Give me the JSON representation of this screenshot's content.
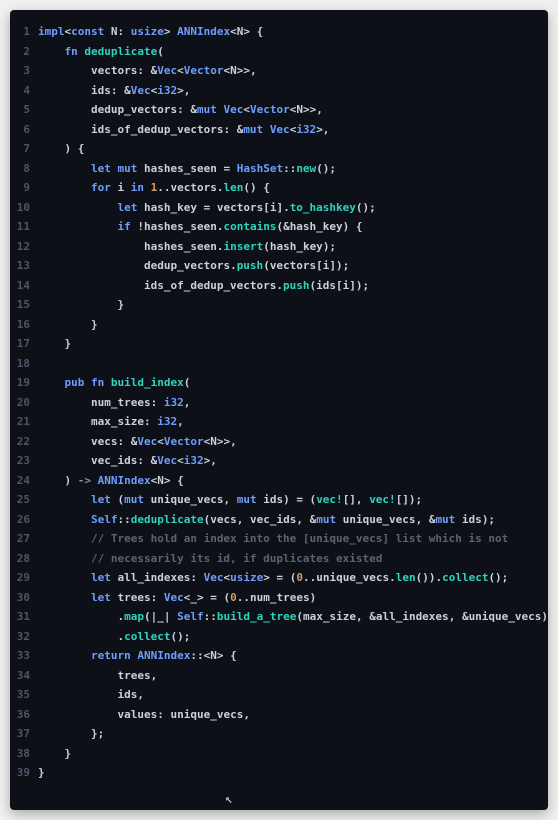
{
  "colors": {
    "bg": "#0d1117",
    "gutter": "#4a5568",
    "default": "#c9d1d9",
    "keyword": "#6f9dff",
    "function": "#2dd4bf",
    "type": "#6f9dff",
    "number": "#d19a66",
    "comment": "#5c6370"
  },
  "lines": [
    {
      "n": 1,
      "tokens": [
        [
          "key",
          "impl"
        ],
        [
          "punct",
          "<"
        ],
        [
          "key",
          "const"
        ],
        [
          "ident",
          " N"
        ],
        [
          "punct",
          ": "
        ],
        [
          "type",
          "usize"
        ],
        [
          "punct",
          "> "
        ],
        [
          "type",
          "ANNIndex"
        ],
        [
          "punct",
          "<"
        ],
        [
          "ident",
          "N"
        ],
        [
          "punct",
          "> {"
        ]
      ]
    },
    {
      "n": 2,
      "indent": 4,
      "tokens": [
        [
          "key",
          "fn "
        ],
        [
          "func",
          "deduplicate"
        ],
        [
          "punct",
          "("
        ]
      ]
    },
    {
      "n": 3,
      "indent": 8,
      "tokens": [
        [
          "ident",
          "vectors"
        ],
        [
          "punct",
          ": "
        ],
        [
          "amp",
          "&"
        ],
        [
          "type",
          "Vec"
        ],
        [
          "punct",
          "<"
        ],
        [
          "type",
          "Vector"
        ],
        [
          "punct",
          "<"
        ],
        [
          "ident",
          "N"
        ],
        [
          "punct",
          ">>,"
        ]
      ]
    },
    {
      "n": 4,
      "indent": 8,
      "tokens": [
        [
          "ident",
          "ids"
        ],
        [
          "punct",
          ": "
        ],
        [
          "amp",
          "&"
        ],
        [
          "type",
          "Vec"
        ],
        [
          "punct",
          "<"
        ],
        [
          "type",
          "i32"
        ],
        [
          "punct",
          ">,"
        ]
      ]
    },
    {
      "n": 5,
      "indent": 8,
      "tokens": [
        [
          "ident",
          "dedup_vectors"
        ],
        [
          "punct",
          ": "
        ],
        [
          "amp",
          "&"
        ],
        [
          "key",
          "mut"
        ],
        [
          "ident",
          " "
        ],
        [
          "type",
          "Vec"
        ],
        [
          "punct",
          "<"
        ],
        [
          "type",
          "Vector"
        ],
        [
          "punct",
          "<"
        ],
        [
          "ident",
          "N"
        ],
        [
          "punct",
          ">>,"
        ]
      ]
    },
    {
      "n": 6,
      "indent": 8,
      "tokens": [
        [
          "ident",
          "ids_of_dedup_vectors"
        ],
        [
          "punct",
          ": "
        ],
        [
          "amp",
          "&"
        ],
        [
          "key",
          "mut"
        ],
        [
          "ident",
          " "
        ],
        [
          "type",
          "Vec"
        ],
        [
          "punct",
          "<"
        ],
        [
          "type",
          "i32"
        ],
        [
          "punct",
          ">,"
        ]
      ]
    },
    {
      "n": 7,
      "indent": 4,
      "tokens": [
        [
          "punct",
          ") {"
        ]
      ]
    },
    {
      "n": 8,
      "indent": 8,
      "tokens": [
        [
          "key",
          "let"
        ],
        [
          "ident",
          " "
        ],
        [
          "key",
          "mut"
        ],
        [
          "ident",
          " hashes_seen = "
        ],
        [
          "type",
          "HashSet"
        ],
        [
          "punct",
          "::"
        ],
        [
          "method",
          "new"
        ],
        [
          "punct",
          "();"
        ]
      ]
    },
    {
      "n": 9,
      "indent": 8,
      "tokens": [
        [
          "key",
          "for"
        ],
        [
          "ident",
          " i "
        ],
        [
          "key",
          "in"
        ],
        [
          "ident",
          " "
        ],
        [
          "num",
          "1"
        ],
        [
          "punct",
          ".."
        ],
        [
          "ident",
          "vectors"
        ],
        [
          "punct",
          "."
        ],
        [
          "method",
          "len"
        ],
        [
          "punct",
          "() {"
        ]
      ]
    },
    {
      "n": 10,
      "indent": 12,
      "tokens": [
        [
          "key",
          "let"
        ],
        [
          "ident",
          " hash_key = vectors["
        ],
        [
          "ident",
          "i"
        ],
        [
          "ident",
          "]"
        ],
        [
          "punct",
          "."
        ],
        [
          "method",
          "to_hashkey"
        ],
        [
          "punct",
          "();"
        ]
      ]
    },
    {
      "n": 11,
      "indent": 12,
      "tokens": [
        [
          "key",
          "if"
        ],
        [
          "ident",
          " !hashes_seen"
        ],
        [
          "punct",
          "."
        ],
        [
          "method",
          "contains"
        ],
        [
          "punct",
          "("
        ],
        [
          "amp",
          "&"
        ],
        [
          "ident",
          "hash_key"
        ],
        [
          "punct",
          ") {"
        ]
      ]
    },
    {
      "n": 12,
      "indent": 16,
      "tokens": [
        [
          "ident",
          "hashes_seen"
        ],
        [
          "punct",
          "."
        ],
        [
          "method",
          "insert"
        ],
        [
          "punct",
          "("
        ],
        [
          "ident",
          "hash_key"
        ],
        [
          "punct",
          ");"
        ]
      ]
    },
    {
      "n": 13,
      "indent": 16,
      "tokens": [
        [
          "ident",
          "dedup_vectors"
        ],
        [
          "punct",
          "."
        ],
        [
          "method",
          "push"
        ],
        [
          "punct",
          "("
        ],
        [
          "ident",
          "vectors"
        ],
        [
          "punct",
          "["
        ],
        [
          "ident",
          "i"
        ],
        [
          "punct",
          "]);"
        ]
      ]
    },
    {
      "n": 14,
      "indent": 16,
      "tokens": [
        [
          "ident",
          "ids_of_dedup_vectors"
        ],
        [
          "punct",
          "."
        ],
        [
          "method",
          "push"
        ],
        [
          "punct",
          "("
        ],
        [
          "ident",
          "ids"
        ],
        [
          "punct",
          "["
        ],
        [
          "ident",
          "i"
        ],
        [
          "punct",
          "]);"
        ]
      ]
    },
    {
      "n": 15,
      "indent": 12,
      "tokens": [
        [
          "punct",
          "}"
        ]
      ]
    },
    {
      "n": 16,
      "indent": 8,
      "tokens": [
        [
          "punct",
          "}"
        ]
      ]
    },
    {
      "n": 17,
      "indent": 4,
      "tokens": [
        [
          "punct",
          "}"
        ]
      ]
    },
    {
      "n": 18,
      "indent": 0,
      "tokens": []
    },
    {
      "n": 19,
      "indent": 4,
      "tokens": [
        [
          "key",
          "pub fn "
        ],
        [
          "func",
          "build_index"
        ],
        [
          "punct",
          "("
        ]
      ]
    },
    {
      "n": 20,
      "indent": 8,
      "tokens": [
        [
          "ident",
          "num_trees"
        ],
        [
          "punct",
          ": "
        ],
        [
          "type",
          "i32"
        ],
        [
          "punct",
          ","
        ]
      ]
    },
    {
      "n": 21,
      "indent": 8,
      "tokens": [
        [
          "ident",
          "max_size"
        ],
        [
          "punct",
          ": "
        ],
        [
          "type",
          "i32"
        ],
        [
          "punct",
          ","
        ]
      ]
    },
    {
      "n": 22,
      "indent": 8,
      "tokens": [
        [
          "ident",
          "vecs"
        ],
        [
          "punct",
          ": "
        ],
        [
          "amp",
          "&"
        ],
        [
          "type",
          "Vec"
        ],
        [
          "punct",
          "<"
        ],
        [
          "type",
          "Vector"
        ],
        [
          "punct",
          "<"
        ],
        [
          "ident",
          "N"
        ],
        [
          "punct",
          ">>,"
        ]
      ]
    },
    {
      "n": 23,
      "indent": 8,
      "tokens": [
        [
          "ident",
          "vec_ids"
        ],
        [
          "punct",
          ": "
        ],
        [
          "amp",
          "&"
        ],
        [
          "type",
          "Vec"
        ],
        [
          "punct",
          "<"
        ],
        [
          "type",
          "i32"
        ],
        [
          "punct",
          ">,"
        ]
      ]
    },
    {
      "n": 24,
      "indent": 4,
      "tokens": [
        [
          "punct",
          ") "
        ],
        [
          "arrow",
          "->"
        ],
        [
          "punct",
          " "
        ],
        [
          "type",
          "ANNIndex"
        ],
        [
          "punct",
          "<"
        ],
        [
          "ident",
          "N"
        ],
        [
          "punct",
          "> {"
        ]
      ]
    },
    {
      "n": 25,
      "indent": 8,
      "tokens": [
        [
          "key",
          "let"
        ],
        [
          "ident",
          " ("
        ],
        [
          "key",
          "mut"
        ],
        [
          "ident",
          " unique_vecs, "
        ],
        [
          "key",
          "mut"
        ],
        [
          "ident",
          " ids) = ("
        ],
        [
          "macro",
          "vec!"
        ],
        [
          "punct",
          "[], "
        ],
        [
          "macro",
          "vec!"
        ],
        [
          "punct",
          "[]);"
        ]
      ]
    },
    {
      "n": 26,
      "indent": 8,
      "tokens": [
        [
          "type",
          "Self"
        ],
        [
          "punct",
          "::"
        ],
        [
          "method",
          "deduplicate"
        ],
        [
          "punct",
          "("
        ],
        [
          "ident",
          "vecs"
        ],
        [
          "punct",
          ", "
        ],
        [
          "ident",
          "vec_ids"
        ],
        [
          "punct",
          ", "
        ],
        [
          "amp",
          "&"
        ],
        [
          "key",
          "mut"
        ],
        [
          "ident",
          " unique_vecs"
        ],
        [
          "punct",
          ", "
        ],
        [
          "amp",
          "&"
        ],
        [
          "key",
          "mut"
        ],
        [
          "ident",
          " ids"
        ],
        [
          "punct",
          ");"
        ]
      ]
    },
    {
      "n": 27,
      "indent": 8,
      "tokens": [
        [
          "comment",
          "// Trees hold an index into the [unique_vecs] list which is not"
        ]
      ]
    },
    {
      "n": 28,
      "indent": 8,
      "tokens": [
        [
          "comment",
          "// necessarily its id, if duplicates existed"
        ]
      ]
    },
    {
      "n": 29,
      "indent": 8,
      "tokens": [
        [
          "key",
          "let"
        ],
        [
          "ident",
          " all_indexes"
        ],
        [
          "punct",
          ": "
        ],
        [
          "type",
          "Vec"
        ],
        [
          "punct",
          "<"
        ],
        [
          "type",
          "usize"
        ],
        [
          "punct",
          "> = ("
        ],
        [
          "num",
          "0"
        ],
        [
          "punct",
          ".."
        ],
        [
          "ident",
          "unique_vecs"
        ],
        [
          "punct",
          "."
        ],
        [
          "method",
          "len"
        ],
        [
          "punct",
          "())."
        ],
        [
          "method",
          "collect"
        ],
        [
          "punct",
          "();"
        ]
      ]
    },
    {
      "n": 30,
      "indent": 8,
      "tokens": [
        [
          "key",
          "let"
        ],
        [
          "ident",
          " trees"
        ],
        [
          "punct",
          ": "
        ],
        [
          "type",
          "Vec"
        ],
        [
          "punct",
          "<_> = ("
        ],
        [
          "num",
          "0"
        ],
        [
          "punct",
          ".."
        ],
        [
          "ident",
          "num_trees"
        ],
        [
          "punct",
          ")"
        ]
      ]
    },
    {
      "n": 31,
      "indent": 12,
      "tokens": [
        [
          "punct",
          "."
        ],
        [
          "method",
          "map"
        ],
        [
          "punct",
          "(|"
        ],
        [
          "ident",
          "_"
        ],
        [
          "punct",
          "| "
        ],
        [
          "type",
          "Self"
        ],
        [
          "punct",
          "::"
        ],
        [
          "method",
          "build_a_tree"
        ],
        [
          "punct",
          "("
        ],
        [
          "ident",
          "max_size"
        ],
        [
          "punct",
          ", "
        ],
        [
          "amp",
          "&"
        ],
        [
          "ident",
          "all_indexes"
        ],
        [
          "punct",
          ", "
        ],
        [
          "amp",
          "&"
        ],
        [
          "ident",
          "unique_vecs"
        ],
        [
          "punct",
          "))"
        ]
      ]
    },
    {
      "n": 32,
      "indent": 12,
      "tokens": [
        [
          "punct",
          "."
        ],
        [
          "method",
          "collect"
        ],
        [
          "punct",
          "();"
        ]
      ]
    },
    {
      "n": 33,
      "indent": 8,
      "tokens": [
        [
          "key",
          "return"
        ],
        [
          "ident",
          " "
        ],
        [
          "type",
          "ANNIndex"
        ],
        [
          "punct",
          "::<"
        ],
        [
          "ident",
          "N"
        ],
        [
          "punct",
          "> {"
        ]
      ]
    },
    {
      "n": 34,
      "indent": 12,
      "tokens": [
        [
          "ident",
          "trees"
        ],
        [
          "punct",
          ","
        ]
      ]
    },
    {
      "n": 35,
      "indent": 12,
      "tokens": [
        [
          "ident",
          "ids"
        ],
        [
          "punct",
          ","
        ]
      ]
    },
    {
      "n": 36,
      "indent": 12,
      "tokens": [
        [
          "ident",
          "values"
        ],
        [
          "punct",
          ": "
        ],
        [
          "ident",
          "unique_vecs"
        ],
        [
          "punct",
          ","
        ]
      ]
    },
    {
      "n": 37,
      "indent": 8,
      "tokens": [
        [
          "punct",
          "};"
        ]
      ]
    },
    {
      "n": 38,
      "indent": 4,
      "tokens": [
        [
          "punct",
          "}"
        ]
      ]
    },
    {
      "n": 39,
      "indent": 0,
      "tokens": [
        [
          "punct",
          "}"
        ]
      ]
    }
  ],
  "cursor": {
    "glyph": "↖"
  }
}
